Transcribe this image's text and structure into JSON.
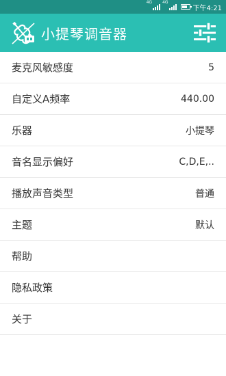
{
  "status_bar": {
    "network_tag_1": "4G",
    "network_tag_2": "4G",
    "time": "下午4:21"
  },
  "app_bar": {
    "title": "小提琴调音器",
    "logo_icon": "violin-logo-icon",
    "settings_icon": "sliders-icon"
  },
  "settings": {
    "items": [
      {
        "label": "麦克风敏感度",
        "value": "5"
      },
      {
        "label": "自定义A频率",
        "value": "440.00"
      },
      {
        "label": "乐器",
        "value": "小提琴"
      },
      {
        "label": "音名显示偏好",
        "value": "C,D,E,.."
      },
      {
        "label": "播放声音类型",
        "value": "普通"
      },
      {
        "label": "主题",
        "value": "默认"
      },
      {
        "label": "帮助",
        "value": ""
      },
      {
        "label": "隐私政策",
        "value": ""
      },
      {
        "label": "关于",
        "value": ""
      }
    ]
  },
  "colors": {
    "app_bar": "#2bbfb3",
    "status_bar": "#1f8f85"
  }
}
